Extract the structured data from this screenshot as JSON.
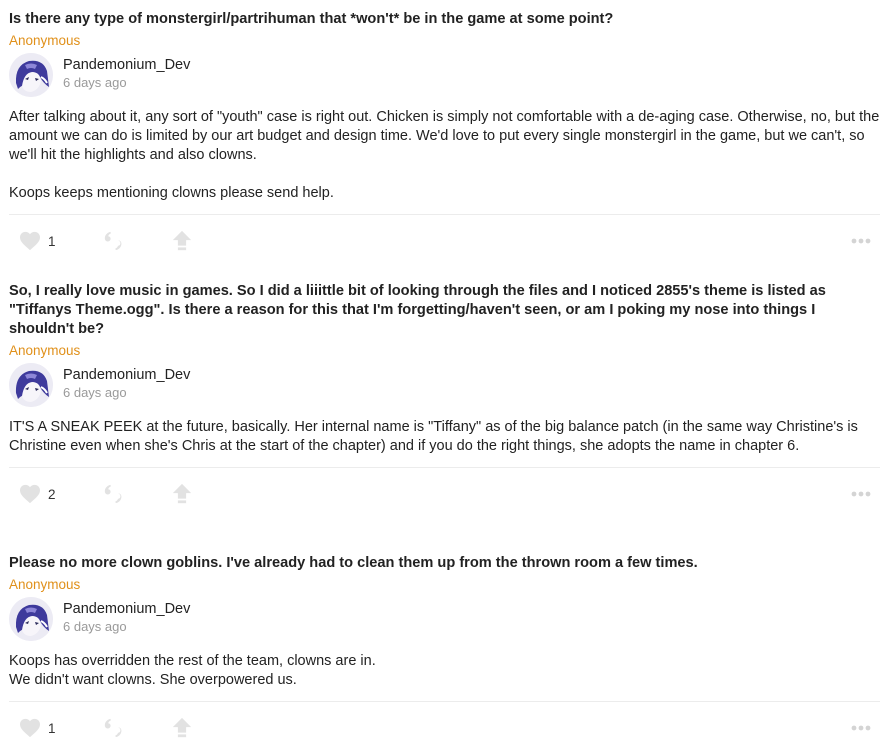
{
  "posts": [
    {
      "question": "Is there any type of monstergirl/partrihuman that *won't* be in the game at some point?",
      "asker": "Anonymous",
      "author": "Pandemonium_Dev",
      "time": "6 days ago",
      "answer": [
        "After talking about it, any sort of \"youth\" case is right out. Chicken is simply not comfortable with a de-aging case. Otherwise, no, but the amount we can do is limited by our art budget and design time. We'd love to put every single monstergirl in the game, but we can't, so we'll hit the highlights and also clowns.",
        "Koops keeps mentioning clowns please send help."
      ],
      "likes": "1"
    },
    {
      "question": "So, I really love music in games. So I did a liiittle bit of looking through the files and I noticed 2855's theme is listed as \"Tiffanys Theme.ogg\". Is there a reason for this that I'm forgetting/haven't seen, or am I poking my nose into things I shouldn't be?",
      "asker": "Anonymous",
      "author": "Pandemonium_Dev",
      "time": "6 days ago",
      "answer": [
        "IT'S A SNEAK PEEK at the future, basically. Her internal name is \"Tiffany\" as of the big balance patch (in the same way Christine's is Christine even when she's Chris at the start of the chapter) and if you do the right things, she adopts the name in chapter 6."
      ],
      "likes": "2"
    },
    {
      "question": "Please no more clown goblins. I've already had to clean them up from the thrown room a few times.",
      "asker": "Anonymous",
      "author": "Pandemonium_Dev",
      "time": "6 days ago",
      "answer": [
        "Koops has overridden the rest of the team, clowns are in.\nWe didn't want clowns. She overpowered us."
      ],
      "likes": "1"
    }
  ],
  "icons": {
    "like": "heart-icon",
    "quote": "quote-icon",
    "share": "share-arrow-icon",
    "more": "more-dots-icon"
  },
  "colors": {
    "asker": "#e0901a",
    "icon": "#e2e2e2",
    "muted": "#9a9a9a",
    "text": "#222222"
  }
}
